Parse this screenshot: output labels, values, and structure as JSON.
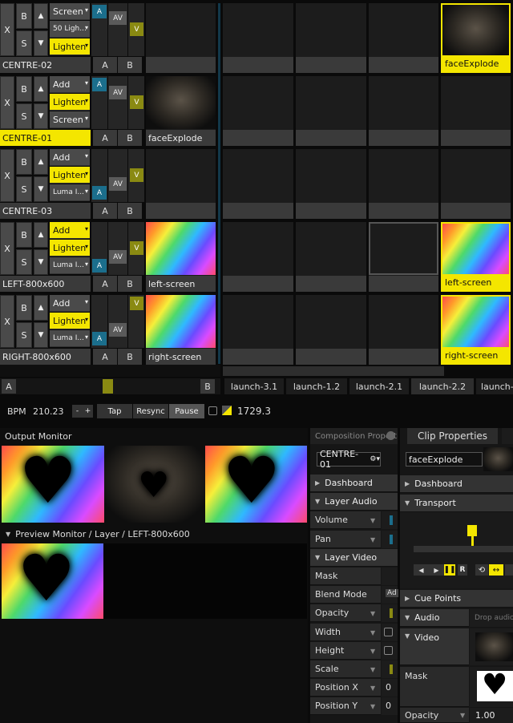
{
  "layers": [
    {
      "name": "CENTRE-02",
      "blend": [
        "Screen",
        "50 Ligh...",
        "Lighten"
      ],
      "clip": "",
      "name_selected": false
    },
    {
      "name": "CENTRE-01",
      "blend": [
        "Add",
        "Lighten",
        "Screen"
      ],
      "clip": "faceExplode",
      "name_selected": true
    },
    {
      "name": "CENTRE-03",
      "blend": [
        "Add",
        "Lighten",
        "Luma I..."
      ],
      "clip": "",
      "name_selected": false
    },
    {
      "name": "LEFT-800x600",
      "blend": [
        "Add",
        "Lighten",
        "Luma I..."
      ],
      "clip": "left-screen",
      "name_selected": false
    },
    {
      "name": "RIGHT-800x600",
      "blend": [
        "Add",
        "Lighten",
        "Luma I..."
      ],
      "clip": "right-screen",
      "name_selected": false
    }
  ],
  "last_column_clips": [
    "faceExplode",
    "",
    "",
    "left-screen",
    "right-screen"
  ],
  "layer_buttons": {
    "x": "X",
    "b": "B",
    "s": "S",
    "up": "▲",
    "down": "▼",
    "a": "A",
    "av": "AV",
    "v": "V",
    "ab_a": "A",
    "ab_b": "B"
  },
  "crossfader": {
    "a": "A",
    "b": "B"
  },
  "deck_tabs": [
    "launch-3.1",
    "launch-1.2",
    "launch-2.1",
    "launch-2.2",
    "launch-"
  ],
  "transport_bar": {
    "bpm_label": "BPM",
    "bpm_value": "210.23",
    "minus": "-",
    "plus": "+",
    "tap": "Tap",
    "resync": "Resync",
    "pause": "Pause",
    "time": "1729.3"
  },
  "output_monitor": {
    "title": "Output Monitor"
  },
  "preview_monitor": {
    "title": "Preview Monitor / Layer / LEFT-800x600"
  },
  "composition_panel": {
    "title": "Composition Properties",
    "selector": "CENTRE-01",
    "rows": [
      {
        "label": "Dashboard",
        "type": "section"
      },
      {
        "label": "Layer Audio",
        "type": "section_open"
      },
      {
        "label": "Volume",
        "type": "param"
      },
      {
        "label": "Pan",
        "type": "param"
      },
      {
        "label": "Layer Video",
        "type": "section_open"
      },
      {
        "label": "Mask",
        "type": "plain"
      },
      {
        "label": "Blend Mode",
        "type": "plain",
        "value": "Ad"
      },
      {
        "label": "Opacity",
        "type": "param"
      },
      {
        "label": "Width",
        "type": "param"
      },
      {
        "label": "Height",
        "type": "param"
      },
      {
        "label": "Scale",
        "type": "param"
      },
      {
        "label": "Position X",
        "type": "param",
        "value": "0"
      },
      {
        "label": "Position Y",
        "type": "param",
        "value": "0"
      }
    ]
  },
  "clip_panel": {
    "tab_active": "Clip Properties",
    "clip_name": "faceExplode",
    "dashboard": "Dashboard",
    "transport": "Transport",
    "cue_points": "Cue Points",
    "audio": "Audio",
    "audio_drop": "Drop audio",
    "video": "Video",
    "mask": "Mask",
    "opacity": "Opacity",
    "opacity_value": "1.00",
    "reverse_btn": "R"
  },
  "colors": {
    "accent_yellow": "#f4e600",
    "teal": "#1b6e8c",
    "olive": "#8a8a12"
  }
}
